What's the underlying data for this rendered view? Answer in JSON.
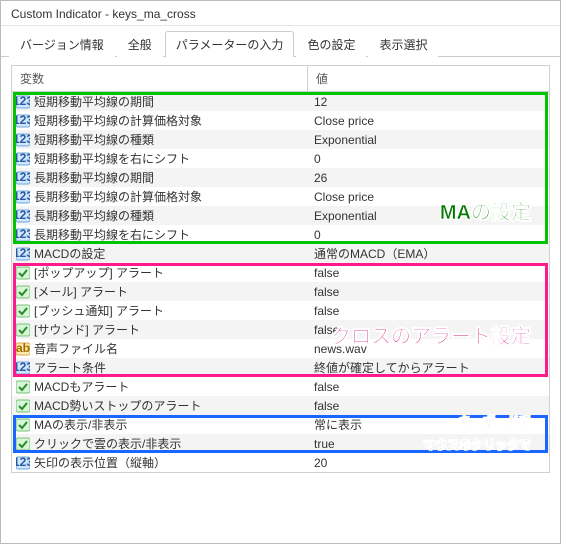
{
  "title": "Custom Indicator - keys_ma_cross",
  "tabs": [
    "バージョン情報",
    "全般",
    "パラメーターの入力",
    "色の設定",
    "表示選択"
  ],
  "activeTab": 2,
  "columns": {
    "var": "変数",
    "val": "値"
  },
  "rows": [
    {
      "icon": "num",
      "label": "短期移動平均線の期間",
      "value": "12"
    },
    {
      "icon": "num",
      "label": "短期移動平均線の計算価格対象",
      "value": "Close price"
    },
    {
      "icon": "num",
      "label": "短期移動平均線の種類",
      "value": "Exponential"
    },
    {
      "icon": "num",
      "label": "短期移動平均線を右にシフト",
      "value": "0"
    },
    {
      "icon": "num",
      "label": "長期移動平均線の期間",
      "value": "26"
    },
    {
      "icon": "num",
      "label": "長期移動平均線の計算価格対象",
      "value": "Close price"
    },
    {
      "icon": "num",
      "label": "長期移動平均線の種類",
      "value": "Exponential"
    },
    {
      "icon": "num",
      "label": "長期移動平均線を右にシフト",
      "value": "0"
    },
    {
      "icon": "num",
      "label": "MACDの設定",
      "value": "通常のMACD（EMA）"
    },
    {
      "icon": "bool",
      "label": "[ポップアップ] アラート",
      "value": "false"
    },
    {
      "icon": "bool",
      "label": "[メール] アラート",
      "value": "false"
    },
    {
      "icon": "bool",
      "label": "[プッシュ通知] アラート",
      "value": "false"
    },
    {
      "icon": "bool",
      "label": "[サウンド] アラート",
      "value": "false"
    },
    {
      "icon": "str",
      "label": "音声ファイル名",
      "value": "news.wav"
    },
    {
      "icon": "num",
      "label": "アラート条件",
      "value": "終値が確定してからアラート"
    },
    {
      "icon": "bool",
      "label": "MACDもアラート",
      "value": "false"
    },
    {
      "icon": "bool",
      "label": "MACD勢いストップのアラート",
      "value": "false"
    },
    {
      "icon": "bool",
      "label": "MAの表示/非表示",
      "value": "常に表示"
    },
    {
      "icon": "bool",
      "label": "クリックで雲の表示/非表示",
      "value": "true"
    },
    {
      "icon": "num",
      "label": "矢印の表示位置（縦軸）",
      "value": "20"
    }
  ],
  "annotations": {
    "green": "MAの設定",
    "pink": "クロスのアラート設定",
    "blue1": "キーボードで",
    "blue2": "マウスのクリックで"
  }
}
